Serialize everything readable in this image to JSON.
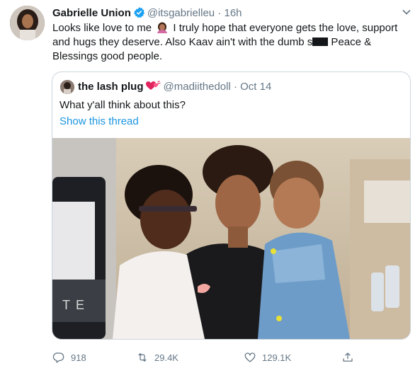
{
  "tweet": {
    "author_name": "Gabrielle Union",
    "handle": "@itsgabrielleu",
    "separator": " · ",
    "time": "16h",
    "text_1": "Looks like love to me ",
    "text_2": " I truly hope that everyone gets the love, support and hugs they deserve. Also Kaav ain't with the dumb s",
    "text_3": " Peace & Blessings good people."
  },
  "quoted": {
    "author_name": "the lash plug",
    "handle": "@madiithedoll",
    "separator": " · ",
    "date": "Oct 14",
    "text": "What y'all think about this?",
    "show_thread": "Show this thread"
  },
  "actions": {
    "replies": "918",
    "retweets": "29.4K",
    "likes": "129.1K"
  },
  "colors": {
    "link": "#1b95e0",
    "muted": "#657786",
    "verified": "#1da1f2",
    "border": "#ccd6dd"
  },
  "icons": [
    "verified-badge-icon",
    "chevron-down-icon",
    "woman-emoji-icon",
    "heart-emoji-icon",
    "reply-icon",
    "retweet-icon",
    "like-icon",
    "share-icon"
  ]
}
